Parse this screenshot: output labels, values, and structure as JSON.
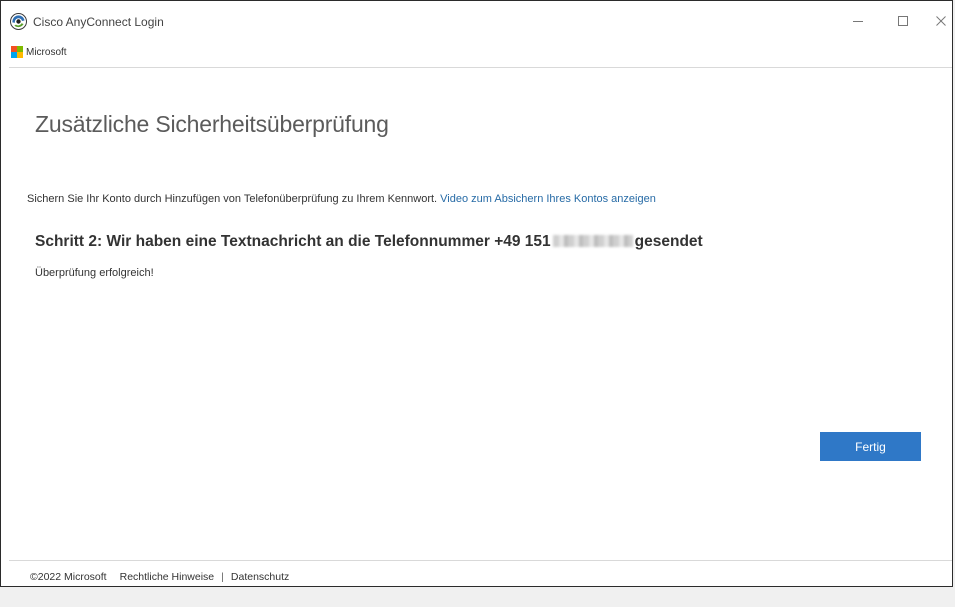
{
  "window": {
    "title": "Cisco AnyConnect Login",
    "controls": {
      "minimize": "minimize-icon",
      "maximize": "maximize-icon",
      "close": "close-icon"
    }
  },
  "brand": {
    "name": "Microsoft",
    "logo_colors": [
      "#f25022",
      "#7fba00",
      "#00a4ef",
      "#ffb900"
    ]
  },
  "main": {
    "title": "Zusätzliche Sicherheitsüberprüfung",
    "intro_text": "Sichern Sie Ihr Konto durch Hinzufügen von Telefonüberprüfung zu Ihrem Kennwort.",
    "intro_link": "Video zum Absichern Ihres Kontos anzeigen",
    "step_prefix": "Schritt 2: Wir haben eine Textnachricht an die Telefonnummer +49 151",
    "step_suffix": "gesendet",
    "status": "Überprüfung erfolgreich!",
    "done_button": "Fertig"
  },
  "footer": {
    "copyright": "©2022 Microsoft",
    "legal": "Rechtliche Hinweise",
    "separator": "|",
    "privacy": "Datenschutz"
  },
  "colors": {
    "accent": "#2f78c7",
    "link": "#276ba6"
  }
}
